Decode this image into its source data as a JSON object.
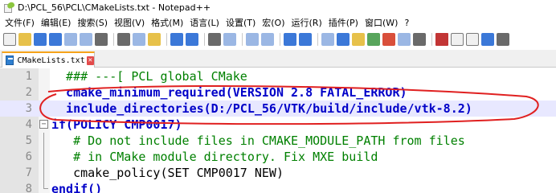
{
  "window": {
    "title": "D:\\PCL_56\\PCL\\CMakeLists.txt - Notepad++"
  },
  "menu": [
    {
      "label": "文件(F)"
    },
    {
      "label": "编辑(E)"
    },
    {
      "label": "搜索(S)"
    },
    {
      "label": "视图(V)"
    },
    {
      "label": "格式(M)"
    },
    {
      "label": "语言(L)"
    },
    {
      "label": "设置(T)"
    },
    {
      "label": "宏(O)"
    },
    {
      "label": "运行(R)"
    },
    {
      "label": "插件(P)"
    },
    {
      "label": "窗口(W)"
    },
    {
      "label": "?"
    }
  ],
  "toolbar_icons": [
    "new-file-icon",
    "open-file-icon",
    "save-icon",
    "save-all-icon",
    "close-icon",
    "close-all-icon",
    "print-icon",
    "cut-icon",
    "copy-icon",
    "paste-icon",
    "undo-icon",
    "redo-icon",
    "find-icon",
    "replace-icon",
    "zoom-in-icon",
    "zoom-out-icon",
    "sync-vertical-icon",
    "sync-horizontal-icon",
    "word-wrap-icon",
    "show-all-chars-icon",
    "indent-guide-icon",
    "doc-map-icon",
    "function-list-icon",
    "folder-workspace-icon",
    "monitor-icon",
    "record-macro-icon",
    "stop-macro-icon",
    "play-macro-icon",
    "run-macro-icon",
    "save-macro-icon"
  ],
  "tab": {
    "label": "CMakeLists.txt"
  },
  "editor": {
    "lines": [
      {
        "num": "1",
        "text": "  ### ---[ PCL global CMake"
      },
      {
        "num": "2",
        "text": "  cmake_minimum_required(VERSION 2.8 FATAL_ERROR)"
      },
      {
        "num": "3",
        "text": "  include_directories(D:/PCL_56/VTK/build/include/vtk-8.2)"
      },
      {
        "num": "4",
        "text": "if(POLICY CMP0017)"
      },
      {
        "num": "5",
        "text": "   # Do not include files in CMAKE_MODULE_PATH from files"
      },
      {
        "num": "6",
        "text": "   # in CMake module directory. Fix MXE build"
      },
      {
        "num": "7",
        "text": "   cmake_policy(SET CMP0017 NEW)"
      },
      {
        "num": "8",
        "text": "endif()"
      }
    ]
  },
  "colors": {
    "comment": "#008000",
    "keyword": "#0000c8",
    "annotation": "#e02020",
    "gutter": "#e4e4e4",
    "tab_accent": "#f6a31a"
  }
}
